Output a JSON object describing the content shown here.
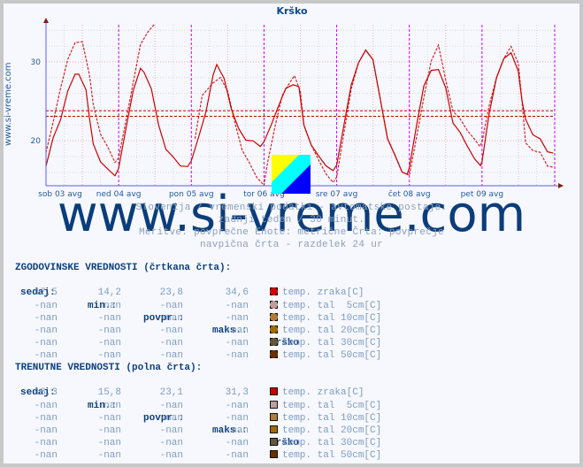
{
  "chart_data": {
    "type": "line",
    "title": "Krško",
    "ylabel": "",
    "xlabel": "",
    "ylim": [
      14.3,
      34.7
    ],
    "yticks": [
      20,
      30
    ],
    "ytick_labels": [
      "20",
      "30"
    ],
    "x_unit": "days since sob 03 avg 00:00",
    "xlim": [
      0,
      7
    ],
    "xtick_labels": [
      "sob 03 avg",
      "ned 04 avg",
      "pon 05 avg",
      "tor 06 avg",
      "sre 07 avg",
      "čet 08 avg",
      "pet 09 avg"
    ],
    "day_separators": [
      1,
      2,
      3,
      4,
      5,
      6,
      7
    ],
    "grid": true,
    "reference_lines": [
      {
        "name": "povprečje zgodovinsko",
        "value": 23.8
      },
      {
        "name": "povprečje trenutno",
        "value": 23.1
      }
    ],
    "series": [
      {
        "name": "temp. zraka[C] (zgodovinske, črtkana)",
        "style": "dashed",
        "color": "#cc0000",
        "x": [
          0.0,
          0.05,
          0.1,
          0.15,
          0.2,
          0.25,
          0.3,
          0.35,
          0.4,
          0.45,
          0.5,
          0.55,
          0.6,
          0.65,
          0.7,
          0.75,
          0.8,
          0.85,
          0.9,
          0.95,
          1.0,
          1.05,
          1.1,
          1.15,
          1.2,
          1.25,
          1.3,
          1.35,
          1.4,
          1.45,
          1.5,
          1.55,
          1.6
        ],
        "values": [
          18.5,
          20.0,
          22.5,
          24.5,
          26.5,
          28.5,
          30.5,
          31.8,
          32.2,
          32.6,
          32.8,
          31.0,
          28.0,
          24.5,
          22.5,
          21.0,
          20.0,
          19.0,
          18.5,
          17.5,
          17.8,
          19.5,
          22.5,
          25.0,
          27.5,
          30.0,
          32.0,
          33.2,
          34.0,
          34.4,
          34.6,
          null,
          null
        ]
      },
      {
        "name": "temp. zraka[C] (trenutne, polna)",
        "style": "solid",
        "color": "#cc0000",
        "x": [
          0.0,
          0.05,
          0.1,
          0.15,
          0.2,
          0.25,
          0.3,
          0.35,
          0.4,
          0.45,
          0.5,
          0.55,
          0.6,
          0.65,
          0.7,
          0.75,
          0.8,
          0.85,
          0.9,
          0.95,
          1.0,
          1.05,
          1.1,
          1.15,
          1.2,
          1.25,
          1.3,
          1.35,
          1.4,
          1.45,
          1.5,
          1.55,
          1.6
        ],
        "values": [
          16.8,
          19.0,
          20.5,
          21.5,
          22.5,
          24.0,
          26.0,
          27.5,
          28.2,
          28.5,
          28.0,
          26.5,
          22.5,
          19.5,
          18.5,
          17.5,
          16.8,
          16.2,
          15.8,
          15.8,
          16.5,
          18.5,
          21.5,
          24.0,
          26.5,
          28.0,
          29.0,
          28.8,
          28.0,
          26.5,
          24.5,
          22.0,
          20.0
        ]
      }
    ],
    "series_values_note": "approximate curves read from the figure; full 7-day traces drawn by script"
  },
  "chart": {
    "side_label": "www.si-vreme.com",
    "watermark": "www.si-vreme.com"
  },
  "info": {
    "line1": "Slovenija / vremenski podatki - avtomatske postaje.",
    "line2": "zadnji teden / 30 minut.",
    "line3": "Meritve: povprečne  Enote: metrične  Črta: povprečje",
    "line4": "navpična črta - razdelek 24 ur"
  },
  "historic": {
    "heading": "ZGODOVINSKE VREDNOSTI (črtkana črta):",
    "cols": [
      "sedaj:",
      "min.:",
      "povpr.:",
      "maks.:"
    ],
    "station": "Krško",
    "rows": [
      {
        "now": "17,5",
        "min": "14,2",
        "avg": "23,8",
        "max": "34,6",
        "label": "temp. zraka[C]",
        "color": "#cc0000"
      },
      {
        "now": "-nan",
        "min": "-nan",
        "avg": "-nan",
        "max": "-nan",
        "label": "temp. tal  5cm[C]",
        "color": "#c09c9c"
      },
      {
        "now": "-nan",
        "min": "-nan",
        "avg": "-nan",
        "max": "-nan",
        "label": "temp. tal 10cm[C]",
        "color": "#b07a3a"
      },
      {
        "now": "-nan",
        "min": "-nan",
        "avg": "-nan",
        "max": "-nan",
        "label": "temp. tal 20cm[C]",
        "color": "#a06a00"
      },
      {
        "now": "-nan",
        "min": "-nan",
        "avg": "-nan",
        "max": "-nan",
        "label": "temp. tal 30cm[C]",
        "color": "#625838"
      },
      {
        "now": "-nan",
        "min": "-nan",
        "avg": "-nan",
        "max": "-nan",
        "label": "temp. tal 50cm[C]",
        "color": "#6a3200"
      }
    ]
  },
  "current": {
    "heading": "TRENUTNE VREDNOSTI (polna črta):",
    "cols": [
      "sedaj:",
      "min.:",
      "povpr.:",
      "maks.:"
    ],
    "station": "Krško",
    "rows": [
      {
        "now": "18,3",
        "min": "15,8",
        "avg": "23,1",
        "max": "31,3",
        "label": "temp. zraka[C]",
        "color": "#cc0000"
      },
      {
        "now": "-nan",
        "min": "-nan",
        "avg": "-nan",
        "max": "-nan",
        "label": "temp. tal  5cm[C]",
        "color": "#c09c9c"
      },
      {
        "now": "-nan",
        "min": "-nan",
        "avg": "-nan",
        "max": "-nan",
        "label": "temp. tal 10cm[C]",
        "color": "#b07a3a"
      },
      {
        "now": "-nan",
        "min": "-nan",
        "avg": "-nan",
        "max": "-nan",
        "label": "temp. tal 20cm[C]",
        "color": "#a06a00"
      },
      {
        "now": "-nan",
        "min": "-nan",
        "avg": "-nan",
        "max": "-nan",
        "label": "temp. tal 30cm[C]",
        "color": "#625838"
      },
      {
        "now": "-nan",
        "min": "-nan",
        "avg": "-nan",
        "max": "-nan",
        "label": "temp. tal 50cm[C]",
        "color": "#6a3200"
      }
    ]
  },
  "colors": {
    "line": "#cc0000",
    "axis": "#5a5aff",
    "day_separator": "#cc00ff",
    "heading": "#0c3f7d",
    "text": "#7d9cc0"
  }
}
